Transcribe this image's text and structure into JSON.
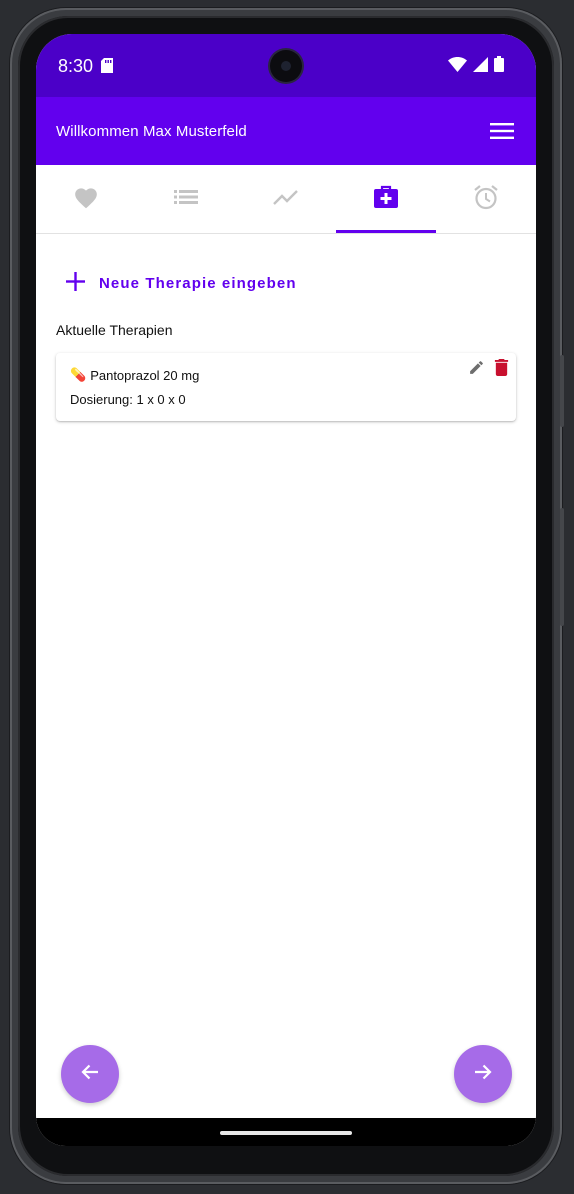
{
  "status_bar": {
    "time": "8:30",
    "icons": [
      "sd-card-icon",
      "wifi-icon",
      "signal-icon",
      "battery-icon"
    ]
  },
  "app_bar": {
    "title": "Willkommen Max Musterfeld",
    "menu_icon": "hamburger-menu-icon"
  },
  "tabs": [
    {
      "icon": "heart-icon",
      "selected": false
    },
    {
      "icon": "list-icon",
      "selected": false
    },
    {
      "icon": "trending-icon",
      "selected": false
    },
    {
      "icon": "medical-bag-icon",
      "selected": true
    },
    {
      "icon": "alarm-clock-icon",
      "selected": false
    }
  ],
  "main": {
    "new_therapy_label": "Neue Therapie eingeben",
    "section_title": "Aktuelle Therapien",
    "therapies": [
      {
        "emoji": "💊",
        "name": "Pantoprazol 20 mg",
        "dosage": "Dosierung: 1 x 0 x 0"
      }
    ]
  },
  "navigation": {
    "prev_icon": "arrow-left-icon",
    "next_icon": "arrow-right-icon"
  },
  "colors": {
    "status_bar": "#4b00c8",
    "primary": "#6200ee",
    "fab": "#a66be8",
    "delete": "#c8102e",
    "inactive_icon": "#c4c4c4"
  }
}
